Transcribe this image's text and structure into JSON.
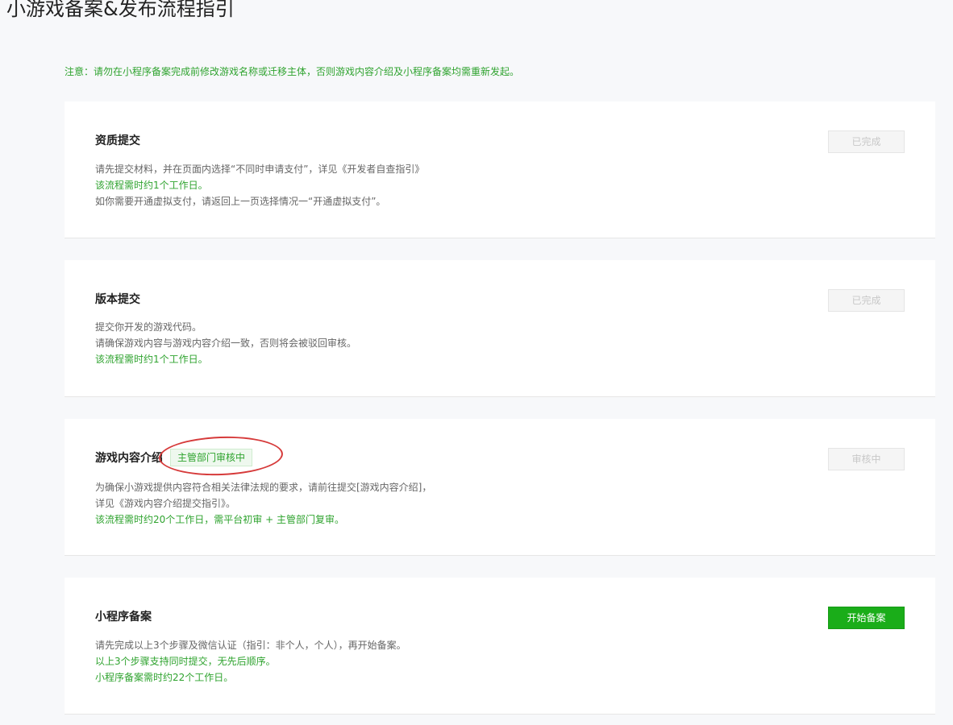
{
  "page": {
    "title": "小游戏备案&发布流程指引",
    "notice": "注意：请勿在小程序备案完成前修改游戏名称或迁移主体，否则游戏内容介绍及小程序备案均需重新发起。"
  },
  "steps": [
    {
      "title": "资质提交",
      "lines": [
        {
          "text": "请先提交材料，并在页面内选择“不同时申请支付”，详见《开发者自查指引》",
          "highlight": false
        },
        {
          "text": "该流程需时约1个工作日。",
          "highlight": true
        },
        {
          "text": "如你需要开通虚拟支付，请返回上一页选择情况一“开通虚拟支付”。",
          "highlight": false
        }
      ],
      "button": "已完成",
      "button_state": "disabled"
    },
    {
      "title": "版本提交",
      "lines": [
        {
          "text": "提交你开发的游戏代码。",
          "highlight": false
        },
        {
          "text": "请确保游戏内容与游戏内容介绍一致，否则将会被驳回审核。",
          "highlight": false
        },
        {
          "text": "该流程需时约1个工作日。",
          "highlight": true
        }
      ],
      "button": "已完成",
      "button_state": "disabled"
    },
    {
      "title": "游戏内容介绍",
      "tag": "主管部门审核中",
      "lines": [
        {
          "text": "为确保小游戏提供内容符合相关法律法规的要求，请前往提交[游戏内容介绍]，",
          "highlight": false
        },
        {
          "text": "详见《游戏内容介绍提交指引》。",
          "highlight": false
        },
        {
          "text": "该流程需时约20个工作日，需平台初审 + 主管部门复审。",
          "highlight": true
        }
      ],
      "button": "审核中",
      "button_state": "disabled"
    },
    {
      "title": "小程序备案",
      "lines": [
        {
          "text": "请先完成以上3个步骤及微信认证（指引：非个人，个人），再开始备案。",
          "highlight": false
        },
        {
          "text": "以上3个步骤支持同时提交，无先后顺序。",
          "highlight": true
        },
        {
          "text": "小程序备案需时约22个工作日。",
          "highlight": true
        }
      ],
      "button": "开始备案",
      "button_state": "primary"
    }
  ],
  "colors": {
    "accent_green": "#2fa32f",
    "primary_button": "#1aad19",
    "annotation_red": "#d63a3a"
  }
}
